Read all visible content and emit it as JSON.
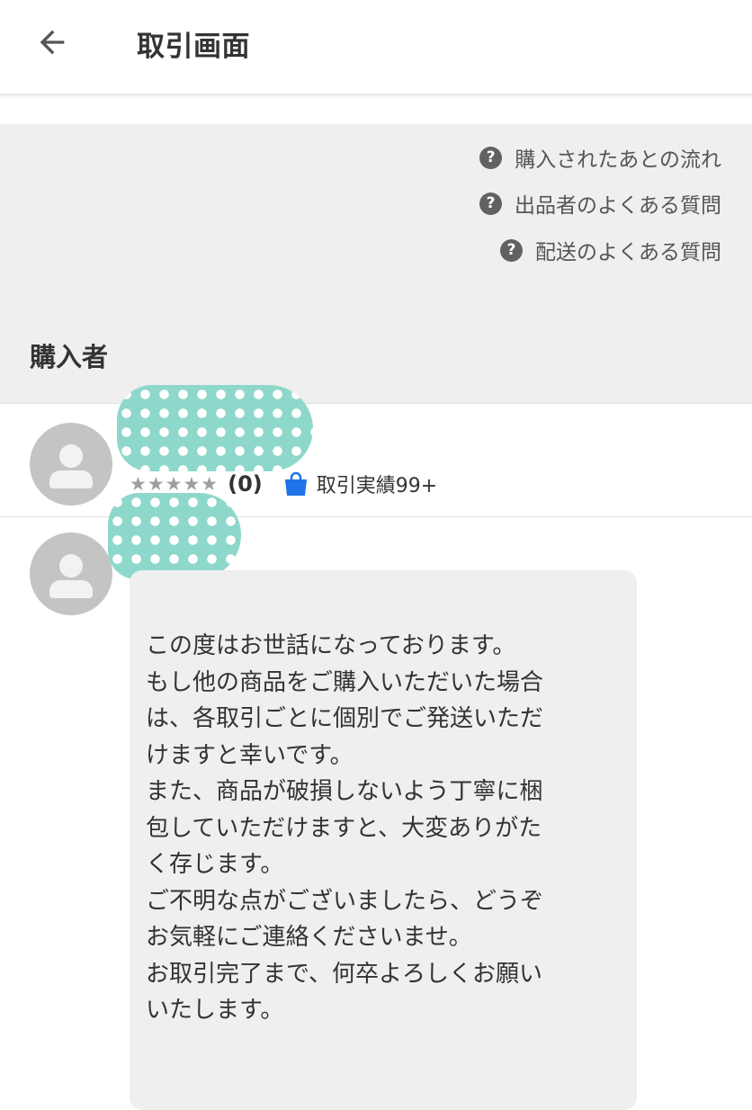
{
  "header": {
    "back_icon": "arrow-left-icon",
    "title": "取引画面"
  },
  "help_links": [
    {
      "icon": "question-circle-icon",
      "label": "購入されたあとの流れ"
    },
    {
      "icon": "question-circle-icon",
      "label": "出品者のよくある質問"
    },
    {
      "icon": "question-circle-icon",
      "label": "配送のよくある質問"
    }
  ],
  "section": {
    "title": "購入者"
  },
  "buyer": {
    "name_redacted": true,
    "stars": "★★★★★",
    "review_count": "(0)",
    "trade_icon": "shopping-bag-icon",
    "trade_count": "取引実績99+"
  },
  "message": {
    "sender_name_redacted": true,
    "lines": [
      "この度はお世話になっております。",
      "もし他の商品をご購入いただいた場合",
      "は、各取引ごとに個別でご発送いただ",
      "けますと幸いです。",
      "また、商品が破損しないよう丁寧に梱",
      "包していただけますと、大変ありがた",
      "く存じます。",
      "ご不明な点がございましたら、どうぞ",
      "お気軽にご連絡くださいませ。",
      "お取引完了まで、何卒よろしくお願い",
      "いたします。"
    ]
  },
  "colors": {
    "info_background": "#efefef",
    "bubble_background": "#efefef",
    "avatar_placeholder": "#c4c4c4",
    "redaction_mint": "#8ed8cb",
    "trade_icon_blue": "#1f73e8"
  }
}
